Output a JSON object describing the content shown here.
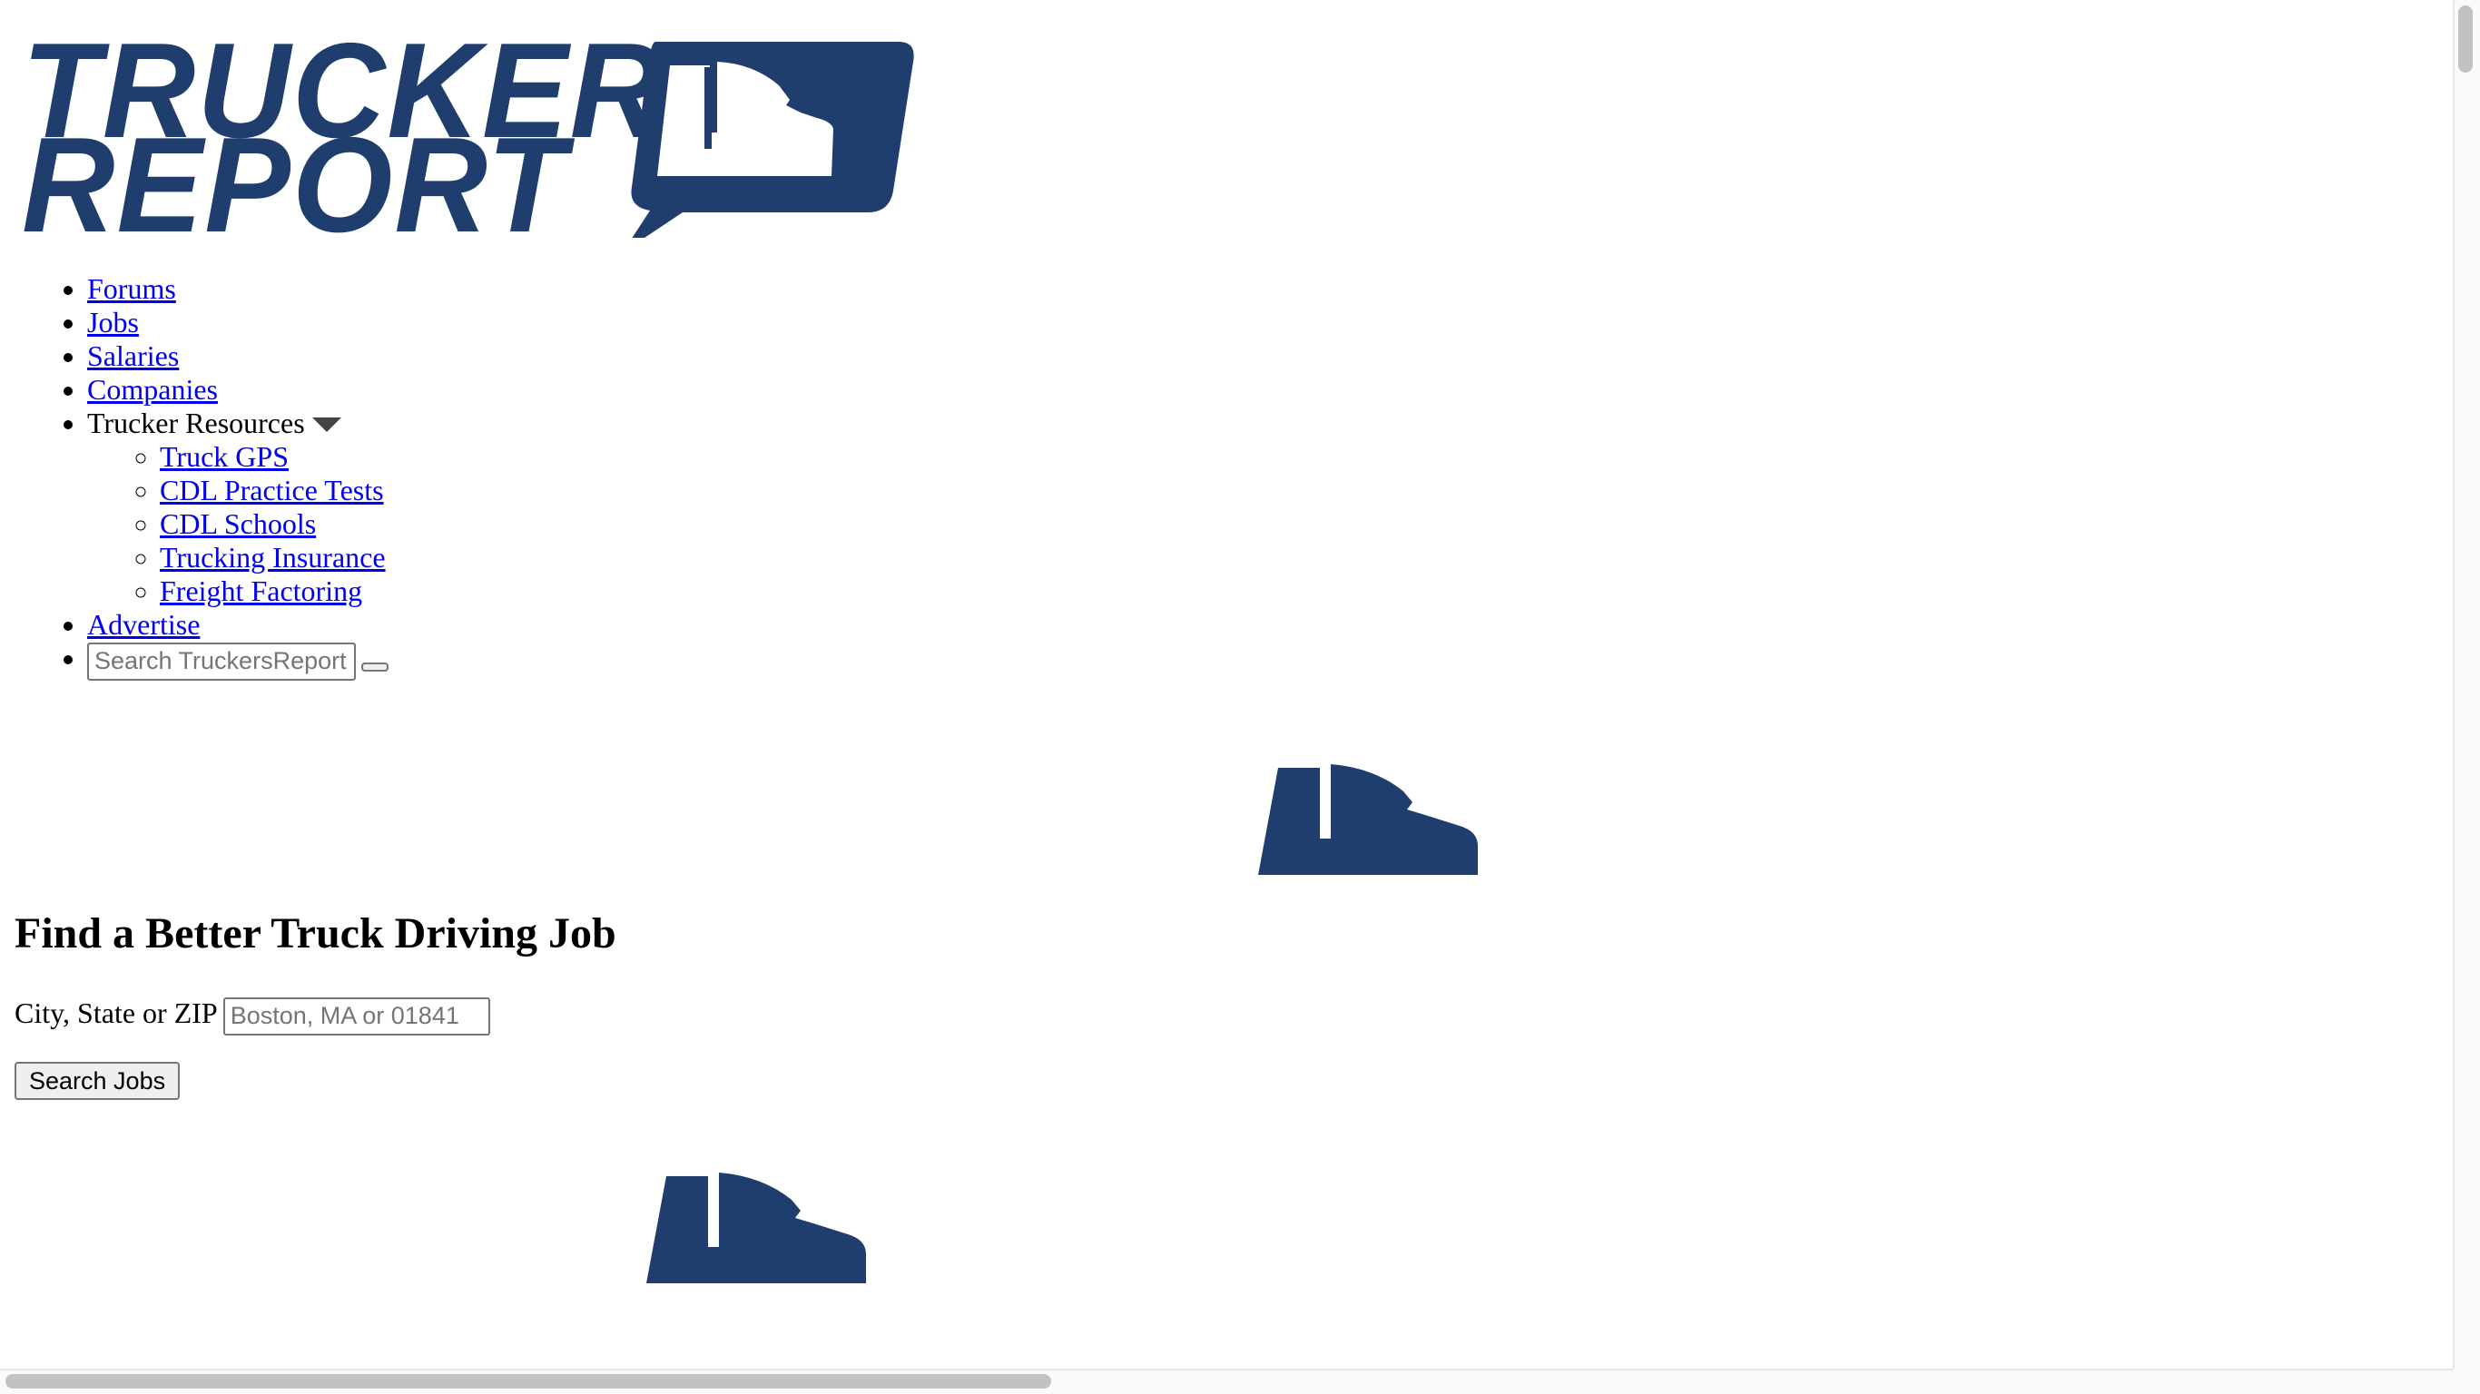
{
  "brand": {
    "logo_line1": "TRUCKERS",
    "logo_line2": "REPORT",
    "logo_icon": "truck-speech-bubble-icon",
    "color": "#1f3d6d"
  },
  "nav": {
    "items": [
      {
        "label": "Forums"
      },
      {
        "label": "Jobs"
      },
      {
        "label": "Salaries"
      },
      {
        "label": "Companies"
      }
    ],
    "resources": {
      "label": "Trucker Resources",
      "icon": "caret-down-icon",
      "items": [
        {
          "label": "Truck GPS"
        },
        {
          "label": "CDL Practice Tests"
        },
        {
          "label": "CDL Schools"
        },
        {
          "label": "Trucking Insurance"
        },
        {
          "label": "Freight Factoring"
        }
      ]
    },
    "advertise": {
      "label": "Advertise"
    },
    "search": {
      "placeholder": "Search TruckersReport",
      "value": "",
      "button_label": ""
    }
  },
  "job_search": {
    "title": "Find a Better Truck Driving Job",
    "location_label": "City, State or ZIP",
    "location_placeholder": "Boston, MA or 01841",
    "location_value": "",
    "button_label": "Search Jobs"
  },
  "icons": [
    "truck-icon",
    "truck-icon"
  ],
  "colors": {
    "link": "#0000ee",
    "brand": "#1f3d6d"
  }
}
